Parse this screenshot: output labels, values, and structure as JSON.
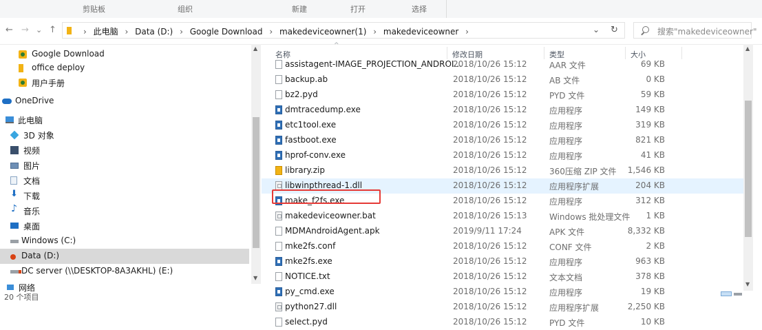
{
  "ribbon": {
    "groups": [
      "剪贴板",
      "组织",
      "新建",
      "打开",
      "选择"
    ]
  },
  "nav_buttons": {
    "back": "←",
    "forward": "→",
    "recent": "⌄",
    "up": "↑"
  },
  "address": {
    "crumbs": [
      "此电脑",
      "Data (D:)",
      "Google Download",
      "makedeviceowner(1)",
      "makedeviceowner"
    ],
    "dropdown": "⌄",
    "refresh": "↻"
  },
  "search": {
    "placeholder": "搜索\"makedeviceowner\""
  },
  "sidebar": {
    "items": [
      {
        "label": "Google Download",
        "icon": "folder-pinned-icon"
      },
      {
        "label": "office deploy",
        "icon": "folder-icon"
      },
      {
        "label": "用户手册",
        "icon": "folder-pinned-icon"
      },
      {
        "label": "OneDrive",
        "icon": "cloud-icon"
      },
      {
        "label": "此电脑",
        "icon": "computer-icon"
      },
      {
        "label": "3D 对象",
        "icon": "cube-icon"
      },
      {
        "label": "视频",
        "icon": "video-icon"
      },
      {
        "label": "图片",
        "icon": "picture-icon"
      },
      {
        "label": "文档",
        "icon": "document-icon"
      },
      {
        "label": "下载",
        "icon": "download-icon"
      },
      {
        "label": "音乐",
        "icon": "music-icon"
      },
      {
        "label": "桌面",
        "icon": "desktop-icon"
      },
      {
        "label": "Windows (C:)",
        "icon": "drive-icon"
      },
      {
        "label": "Data (D:)",
        "icon": "drive-icon"
      },
      {
        "label": "DC server (\\\\DESKTOP-8A3AKHL) (E:)",
        "icon": "network-drive-icon"
      },
      {
        "label": "网络",
        "icon": "network-icon"
      }
    ],
    "status_text": "20 个项目"
  },
  "columns": {
    "name": "名称",
    "date": "修改日期",
    "type": "类型",
    "size": "大小"
  },
  "files": [
    {
      "name": "assistagent-IMAGE_PROJECTION_ANDROI...",
      "date": "2018/10/26 15:12",
      "type": "AAR 文件",
      "size": "69 KB",
      "icon": "doc"
    },
    {
      "name": "backup.ab",
      "date": "2018/10/26 15:12",
      "type": "AB 文件",
      "size": "0 KB",
      "icon": "doc"
    },
    {
      "name": "bz2.pyd",
      "date": "2018/10/26 15:12",
      "type": "PYD 文件",
      "size": "59 KB",
      "icon": "doc"
    },
    {
      "name": "dmtracedump.exe",
      "date": "2018/10/26 15:12",
      "type": "应用程序",
      "size": "149 KB",
      "icon": "exe"
    },
    {
      "name": "etc1tool.exe",
      "date": "2018/10/26 15:12",
      "type": "应用程序",
      "size": "319 KB",
      "icon": "exe"
    },
    {
      "name": "fastboot.exe",
      "date": "2018/10/26 15:12",
      "type": "应用程序",
      "size": "821 KB",
      "icon": "exe"
    },
    {
      "name": "hprof-conv.exe",
      "date": "2018/10/26 15:12",
      "type": "应用程序",
      "size": "41 KB",
      "icon": "exe"
    },
    {
      "name": "library.zip",
      "date": "2018/10/26 15:12",
      "type": "360压缩 ZIP 文件",
      "size": "1,546 KB",
      "icon": "zip"
    },
    {
      "name": "libwinpthread-1.dll",
      "date": "2018/10/26 15:12",
      "type": "应用程序扩展",
      "size": "204 KB",
      "icon": "dll"
    },
    {
      "name": "make_f2fs.exe",
      "date": "2018/10/26 15:12",
      "type": "应用程序",
      "size": "312 KB",
      "icon": "exe"
    },
    {
      "name": "makedeviceowner.bat",
      "date": "2018/10/26 15:13",
      "type": "Windows 批处理文件",
      "size": "1 KB",
      "icon": "dll"
    },
    {
      "name": "MDMAndroidAgent.apk",
      "date": "2019/9/11 17:24",
      "type": "APK 文件",
      "size": "8,332 KB",
      "icon": "doc"
    },
    {
      "name": "mke2fs.conf",
      "date": "2018/10/26 15:12",
      "type": "CONF 文件",
      "size": "2 KB",
      "icon": "doc"
    },
    {
      "name": "mke2fs.exe",
      "date": "2018/10/26 15:12",
      "type": "应用程序",
      "size": "963 KB",
      "icon": "exe"
    },
    {
      "name": "NOTICE.txt",
      "date": "2018/10/26 15:12",
      "type": "文本文档",
      "size": "378 KB",
      "icon": "doc"
    },
    {
      "name": "py_cmd.exe",
      "date": "2018/10/26 15:12",
      "type": "应用程序",
      "size": "19 KB",
      "icon": "exe"
    },
    {
      "name": "python27.dll",
      "date": "2018/10/26 15:12",
      "type": "应用程序扩展",
      "size": "2,250 KB",
      "icon": "dll"
    },
    {
      "name": "select.pyd",
      "date": "2018/10/26 15:12",
      "type": "PYD 文件",
      "size": "10 KB",
      "icon": "doc"
    }
  ],
  "colors": {
    "hover_row": "#e5f3ff",
    "selected_nav": "#d9d9d9",
    "highlight_box": "#e53935",
    "folder": "#f2b315"
  }
}
